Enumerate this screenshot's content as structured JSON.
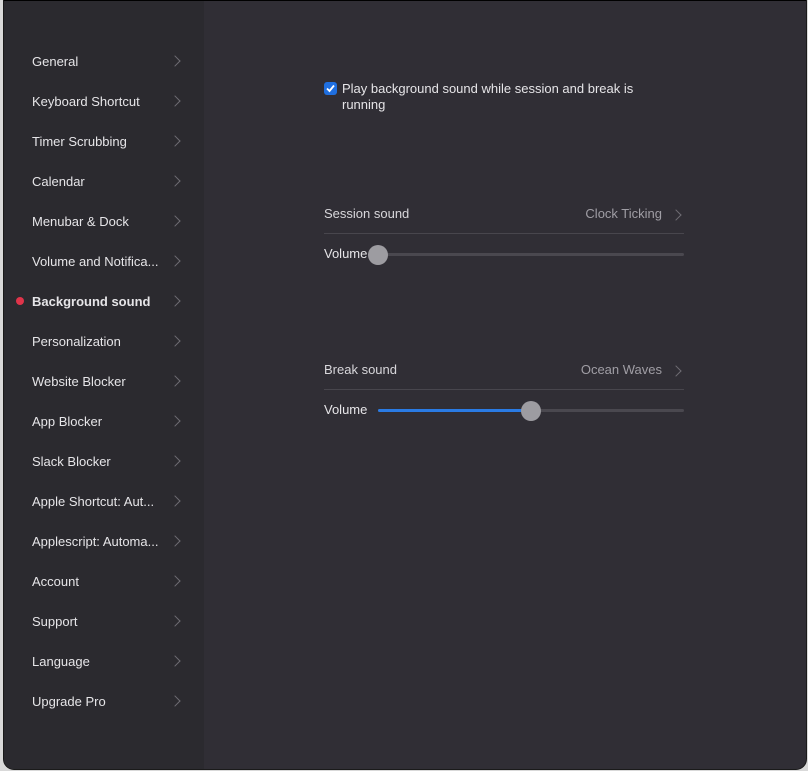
{
  "sidebar": {
    "active_index": 6,
    "items": [
      {
        "label": "General"
      },
      {
        "label": "Keyboard Shortcut"
      },
      {
        "label": "Timer Scrubbing"
      },
      {
        "label": "Calendar"
      },
      {
        "label": "Menubar & Dock"
      },
      {
        "label": "Volume and Notifica..."
      },
      {
        "label": "Background sound"
      },
      {
        "label": "Personalization"
      },
      {
        "label": "Website Blocker"
      },
      {
        "label": "App Blocker"
      },
      {
        "label": "Slack Blocker"
      },
      {
        "label": "Apple Shortcut: Aut..."
      },
      {
        "label": "Applescript: Automa..."
      },
      {
        "label": "Account"
      },
      {
        "label": "Support"
      },
      {
        "label": "Language"
      },
      {
        "label": "Upgrade Pro"
      }
    ]
  },
  "main": {
    "play_background": {
      "label": "Play background sound while session and break is running",
      "checked": true
    },
    "session": {
      "label": "Session sound",
      "value": "Clock Ticking",
      "volume_label": "Volume",
      "volume": 0
    },
    "break": {
      "label": "Break sound",
      "value": "Ocean Waves",
      "volume_label": "Volume",
      "volume": 0.5
    }
  },
  "colors": {
    "accent": "#2a7be4",
    "active_dot": "#e0344a",
    "sidebar_bg": "#2b2a2f",
    "main_bg": "#302e35"
  }
}
